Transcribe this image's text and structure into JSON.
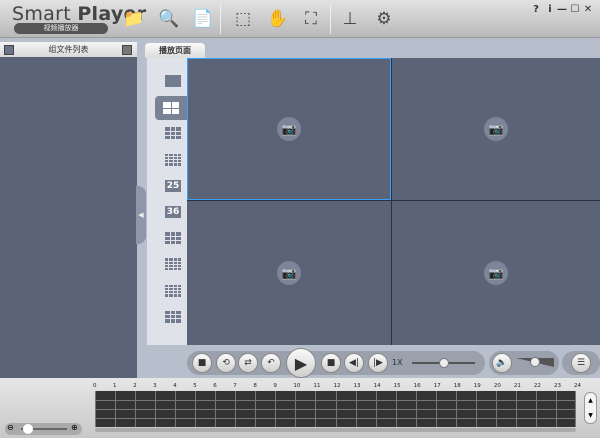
{
  "app": {
    "title_plain": "Smart ",
    "title_bold": "Player",
    "subtitle": "视频播放器"
  },
  "toolbar": [
    {
      "icon": "folder-add-icon",
      "glyph": "📁"
    },
    {
      "icon": "search-layout-icon",
      "glyph": "🔍"
    },
    {
      "icon": "export-file-icon",
      "glyph": "📄"
    },
    {
      "icon": "select-pointer-icon",
      "glyph": "⬚"
    },
    {
      "icon": "hand-icon",
      "glyph": "✋"
    },
    {
      "icon": "fullscreen-icon",
      "glyph": "⛶"
    },
    {
      "icon": "stamp-icon",
      "glyph": "⊥"
    },
    {
      "icon": "gear-icon",
      "glyph": "⚙"
    }
  ],
  "window_controls": {
    "help": "?",
    "info": "i",
    "minimize": "—",
    "maximize": "☐",
    "close": "✕"
  },
  "left_panel": {
    "title": "组文件列表"
  },
  "tab": {
    "label": "播放页面"
  },
  "layouts": [
    {
      "name": "1"
    },
    {
      "name": "4",
      "selected": true
    },
    {
      "name": "9"
    },
    {
      "name": "16"
    },
    {
      "name": "25",
      "label": "25"
    },
    {
      "name": "36",
      "label": "36"
    },
    {
      "name": "6"
    },
    {
      "name": "8"
    },
    {
      "name": "13"
    },
    {
      "name": "custom"
    }
  ],
  "controls": {
    "speed": "1X",
    "speed_position": 0.5,
    "volume_position": 0.5
  },
  "timeline": {
    "ticks": [
      "0",
      "1",
      "2",
      "3",
      "4",
      "5",
      "6",
      "7",
      "8",
      "9",
      "10",
      "11",
      "12",
      "13",
      "14",
      "15",
      "16",
      "17",
      "18",
      "19",
      "20",
      "21",
      "22",
      "23",
      "24"
    ],
    "zoom_position": 0.05
  },
  "colors": {
    "accent": "#3aa0ff",
    "video_bg": "#5b6376"
  }
}
